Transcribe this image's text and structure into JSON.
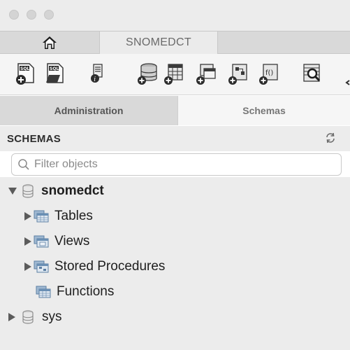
{
  "window": {
    "title": ""
  },
  "tabs": {
    "home_icon": "home-icon",
    "connection_tab_label": "SNOMEDCT"
  },
  "toolbar": {
    "buttons": [
      {
        "icon": "new-sql-tab-icon"
      },
      {
        "icon": "open-sql-script-icon"
      },
      {
        "icon": "server-info-icon"
      },
      {
        "icon": "create-schema-icon"
      },
      {
        "icon": "create-table-icon"
      },
      {
        "icon": "create-view-icon"
      },
      {
        "icon": "create-stored-procedure-icon"
      },
      {
        "icon": "create-function-icon"
      },
      {
        "icon": "search-table-data-icon"
      }
    ]
  },
  "navigator": {
    "tabs": [
      "Administration",
      "Schemas"
    ],
    "active_tab": "Administration"
  },
  "schemas_panel": {
    "title": "SCHEMAS",
    "filter_placeholder": "Filter objects",
    "tree": [
      {
        "label": "snomedct",
        "expanded": true,
        "children": [
          "Tables",
          "Views",
          "Stored Procedures",
          "Functions"
        ]
      },
      {
        "label": "sys",
        "expanded": false
      }
    ]
  },
  "colors": {
    "panel_bg": "#ececec",
    "db_cylinder_gray": "#8d8d8d",
    "tree_icon_blue": "#6a8fb4"
  }
}
